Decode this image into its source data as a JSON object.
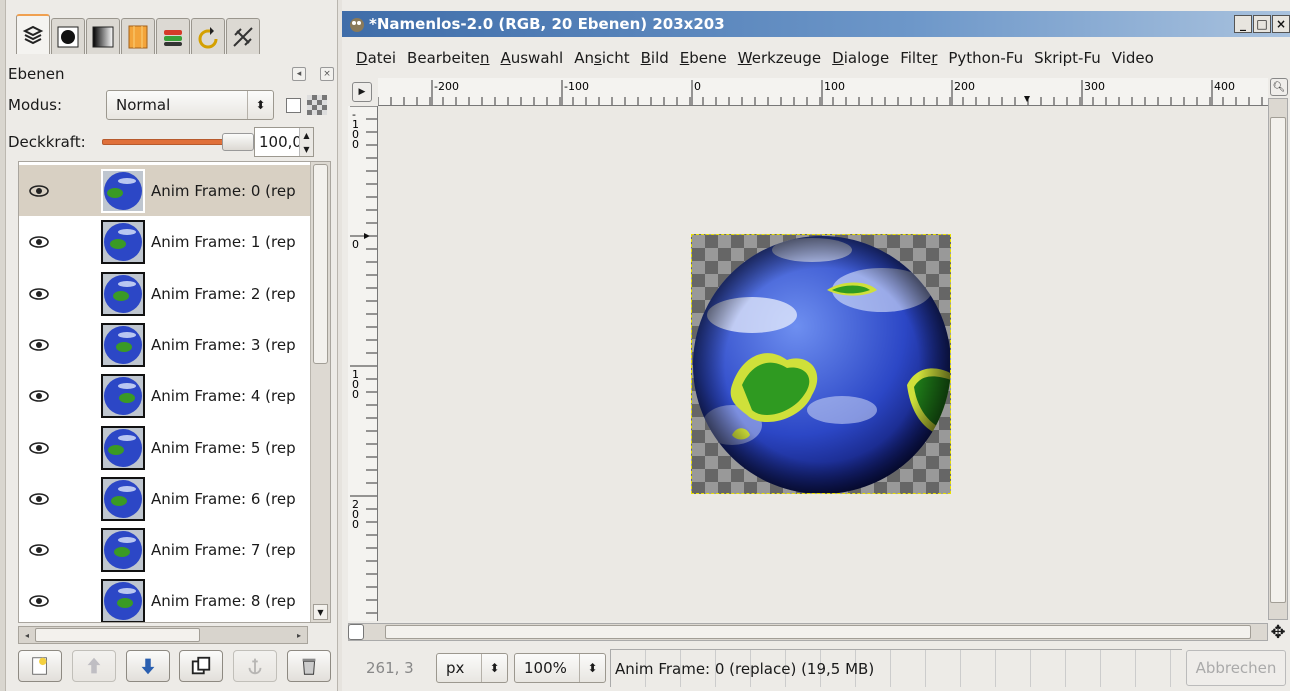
{
  "dock": {
    "title": "Ebenen",
    "tab_icons": [
      "layers-icon",
      "channels-icon",
      "paths-icon",
      "gradient-icon",
      "palettes-icon",
      "undo-history-icon",
      "tool-options-icon"
    ],
    "mode_label": "Modus:",
    "mode_value": "Normal",
    "opacity_label": "Deckkraft:",
    "opacity_value": "100,0",
    "opacity_fraction": 1.0,
    "layers": [
      {
        "name": "Anim Frame: 0 (rep",
        "visible": true,
        "selected": true
      },
      {
        "name": "Anim Frame: 1 (rep",
        "visible": true,
        "selected": false
      },
      {
        "name": "Anim Frame: 2 (rep",
        "visible": true,
        "selected": false
      },
      {
        "name": "Anim Frame: 3 (rep",
        "visible": true,
        "selected": false
      },
      {
        "name": "Anim Frame: 4 (rep",
        "visible": true,
        "selected": false
      },
      {
        "name": "Anim Frame: 5 (rep",
        "visible": true,
        "selected": false
      },
      {
        "name": "Anim Frame: 6 (rep",
        "visible": true,
        "selected": false
      },
      {
        "name": "Anim Frame: 7 (rep",
        "visible": true,
        "selected": false
      },
      {
        "name": "Anim Frame: 8 (rep",
        "visible": true,
        "selected": false
      }
    ],
    "buttons": [
      "new-layer-icon",
      "raise-layer-icon",
      "lower-layer-icon",
      "duplicate-layer-icon",
      "anchor-layer-icon",
      "delete-layer-icon"
    ]
  },
  "window": {
    "title": "*Namenlos-2.0 (RGB, 20 Ebenen) 203x203",
    "controls": [
      "_",
      "□",
      "×"
    ],
    "menu": [
      {
        "pre": "",
        "u": "D",
        "post": "atei"
      },
      {
        "pre": "Bearbeite",
        "u": "n",
        "post": ""
      },
      {
        "pre": "",
        "u": "A",
        "post": "uswahl"
      },
      {
        "pre": "An",
        "u": "s",
        "post": "icht"
      },
      {
        "pre": "",
        "u": "B",
        "post": "ild"
      },
      {
        "pre": "",
        "u": "E",
        "post": "bene"
      },
      {
        "pre": "",
        "u": "W",
        "post": "erkzeuge"
      },
      {
        "pre": "",
        "u": "D",
        "post": "ialoge"
      },
      {
        "pre": "Filte",
        "u": "r",
        "post": ""
      },
      {
        "pre": "Python-Fu",
        "u": "",
        "post": ""
      },
      {
        "pre": "Skript-Fu",
        "u": "",
        "post": ""
      },
      {
        "pre": "Video",
        "u": "",
        "post": ""
      }
    ],
    "hruler_labels": [
      "-200",
      "-100",
      "0",
      "100",
      "200",
      "300",
      "400"
    ],
    "vruler_labels": [
      "-100",
      "0",
      "100",
      "200"
    ]
  },
  "status": {
    "coords": "261, 3",
    "unit": "px",
    "zoom": "100%",
    "message": "Anim Frame: 0 (replace) (19,5 MB)",
    "cancel": "Abbrechen"
  }
}
